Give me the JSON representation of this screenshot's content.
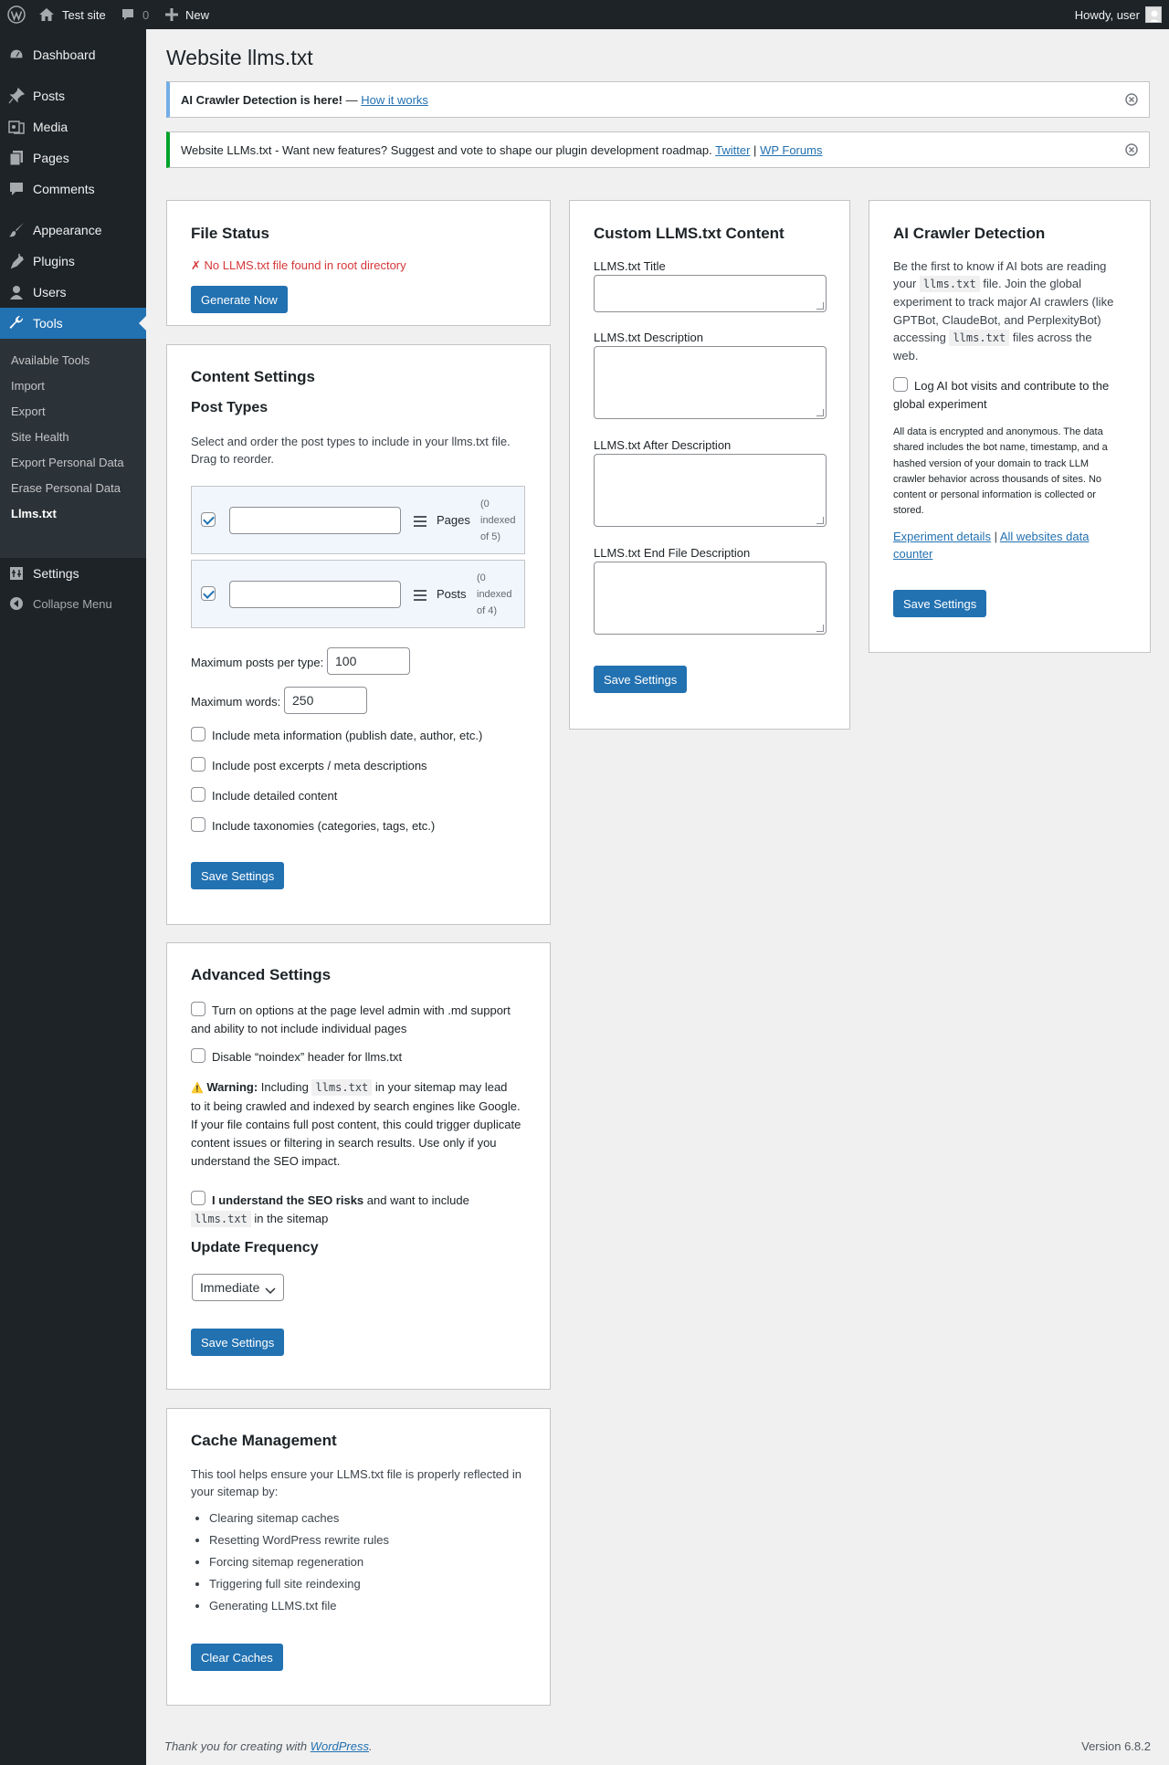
{
  "adminbar": {
    "site_name": "Test site",
    "comment_count": "0",
    "new_label": "New",
    "howdy": "Howdy, user"
  },
  "sidebar": {
    "items": [
      {
        "label": "Dashboard",
        "icon": "dashboard-icon"
      },
      {
        "label": "Posts",
        "icon": "pin-icon"
      },
      {
        "label": "Media",
        "icon": "media-icon"
      },
      {
        "label": "Pages",
        "icon": "pages-icon"
      },
      {
        "label": "Comments",
        "icon": "comments-icon"
      },
      {
        "label": "Appearance",
        "icon": "brush-icon"
      },
      {
        "label": "Plugins",
        "icon": "plug-icon"
      },
      {
        "label": "Users",
        "icon": "users-icon"
      },
      {
        "label": "Tools",
        "icon": "wrench-icon"
      },
      {
        "label": "Settings",
        "icon": "settings-icon"
      },
      {
        "label": "Collapse Menu",
        "icon": "collapse-icon"
      }
    ],
    "submenu": [
      "Available Tools",
      "Import",
      "Export",
      "Site Health",
      "Export Personal Data",
      "Erase Personal Data",
      "Llms.txt"
    ],
    "accent_color": "#2271b1"
  },
  "page": {
    "title": "Website llms.txt"
  },
  "notices": {
    "crawler_bold": "AI Crawler Detection is here!",
    "crawler_sep": " — ",
    "crawler_link": "How it works",
    "features_text": "Website LLMs.txt - Want new features? Suggest and vote to shape our plugin development roadmap.",
    "twitter": "Twitter",
    "pipe": "|",
    "forums": "WP Forums"
  },
  "file_status": {
    "title": "File Status",
    "error_mark": "✗",
    "error_text": "No LLMS.txt file found in root directory",
    "button": "Generate Now"
  },
  "content_settings": {
    "title": "Content Settings",
    "post_types_title": "Post Types",
    "desc": "Select and order the post types to include in your llms.txt file. Drag to reorder.",
    "rows": [
      {
        "label": "Pages",
        "count_1": "(0",
        "count_2": "indexed",
        "count_3": "of 5)"
      },
      {
        "label": "Posts",
        "count_1": "(0",
        "count_2": "indexed",
        "count_3": "of 4)"
      }
    ],
    "max_posts_label": "Maximum posts per type:",
    "max_posts_value": "100",
    "max_words_label": "Maximum words:",
    "max_words_value": "250",
    "options": [
      "Include meta information (publish date, author, etc.)",
      "Include post excerpts / meta descriptions",
      "Include detailed content",
      "Include taxonomies (categories, tags, etc.)"
    ],
    "save": "Save Settings"
  },
  "advanced": {
    "title": "Advanced Settings",
    "opt1_line1": "Turn on options at the page level admin with .md support",
    "opt1_line2": "and ability to not include individual pages",
    "opt2": "Disable “noindex” header for llms.txt",
    "warning_icon": "⚠️",
    "warning_bold": "Warning:",
    "warning_pre": "Including",
    "warning_code": "llms.txt",
    "warning_post": "in your sitemap may lead",
    "warning_lines": [
      "to it being crawled and indexed by search engines like Google.",
      "If your file contains full post content, this could trigger duplicate",
      "content issues or filtering in search results. Use only if you",
      "understand the SEO impact."
    ],
    "seo_bold": "I understand the SEO risks",
    "seo_rest": "and want to include",
    "seo_code": "llms.txt",
    "seo_tail": "in the sitemap",
    "freq_title": "Update Frequency",
    "freq_value": "Immediate",
    "save": "Save Settings"
  },
  "cache": {
    "title": "Cache Management",
    "desc_line1": "This tool helps ensure your LLMS.txt file is properly reflected in",
    "desc_line2": "your sitemap by:",
    "items": [
      "Clearing sitemap caches",
      "Resetting WordPress rewrite rules",
      "Forcing sitemap regeneration",
      "Triggering full site reindexing",
      "Generating LLMS.txt file"
    ],
    "button": "Clear Caches"
  },
  "custom": {
    "title": "Custom LLMS.txt Content",
    "field_title": "LLMS.txt Title",
    "field_desc": "LLMS.txt Description",
    "field_after": "LLMS.txt After Description",
    "field_end": "LLMS.txt End File Description",
    "save": "Save Settings"
  },
  "crawler": {
    "title": "AI Crawler Detection",
    "l1": "Be the first to know if AI bots are reading",
    "l2_pre": "your",
    "code": "llms.txt",
    "l2_post": "file. Join the global",
    "l3": "experiment to track major AI crawlers (like",
    "l4": "GPTBot, ClaudeBot, and PerplexityBot)",
    "l5_pre": "accessing",
    "l5_post": "files across the",
    "l6": "web.",
    "opt_line1": "Log AI bot visits and contribute to the",
    "opt_line2": "global experiment",
    "small_lines": [
      "All data is encrypted and anonymous. The data",
      "shared includes the bot name, timestamp, and a",
      "hashed version of your domain to track LLM",
      "crawler behavior across thousands of sites. No",
      "content or personal information is collected or",
      "stored."
    ],
    "link1": "Experiment details",
    "pipe": "|",
    "link2_l1": "All websites data",
    "link2_l2": "counter",
    "save": "Save Settings"
  },
  "footer": {
    "pre": "Thank you for creating with",
    "link": "WordPress",
    "post": ".",
    "version": "Version 6.8.2"
  }
}
